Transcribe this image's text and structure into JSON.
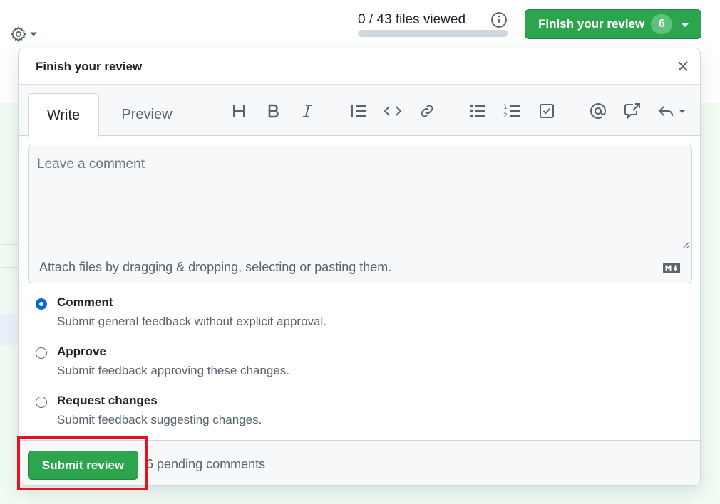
{
  "header": {
    "progress": {
      "text": "0 / 43 files viewed",
      "viewed": 0,
      "total": 43
    },
    "finish_button": {
      "label": "Finish your review",
      "count": "6"
    }
  },
  "popover": {
    "title": "Finish your review",
    "tabs": [
      {
        "label": "Write",
        "active": true
      },
      {
        "label": "Preview",
        "active": false
      }
    ],
    "toolbar": [
      "heading-icon",
      "bold-icon",
      "italic-icon",
      "quote-icon",
      "code-icon",
      "link-icon",
      "unordered-list-icon",
      "ordered-list-icon",
      "task-list-icon",
      "mention-icon",
      "cross-reference-icon",
      "saved-replies-icon"
    ],
    "comment": {
      "value": "",
      "placeholder": "Leave a comment"
    },
    "attach_text": "Attach files by dragging & dropping, selecting or pasting them.",
    "options": [
      {
        "label": "Comment",
        "description": "Submit general feedback without explicit approval.",
        "checked": true
      },
      {
        "label": "Approve",
        "description": "Submit feedback approving these changes.",
        "checked": false
      },
      {
        "label": "Request changes",
        "description": "Submit feedback suggesting changes.",
        "checked": false
      }
    ],
    "submit_label": "Submit review",
    "pending_text": "6 pending comments"
  },
  "colors": {
    "primary_green": "#2da44e",
    "accent_blue": "#0969da",
    "highlight_red": "#e3141e"
  }
}
